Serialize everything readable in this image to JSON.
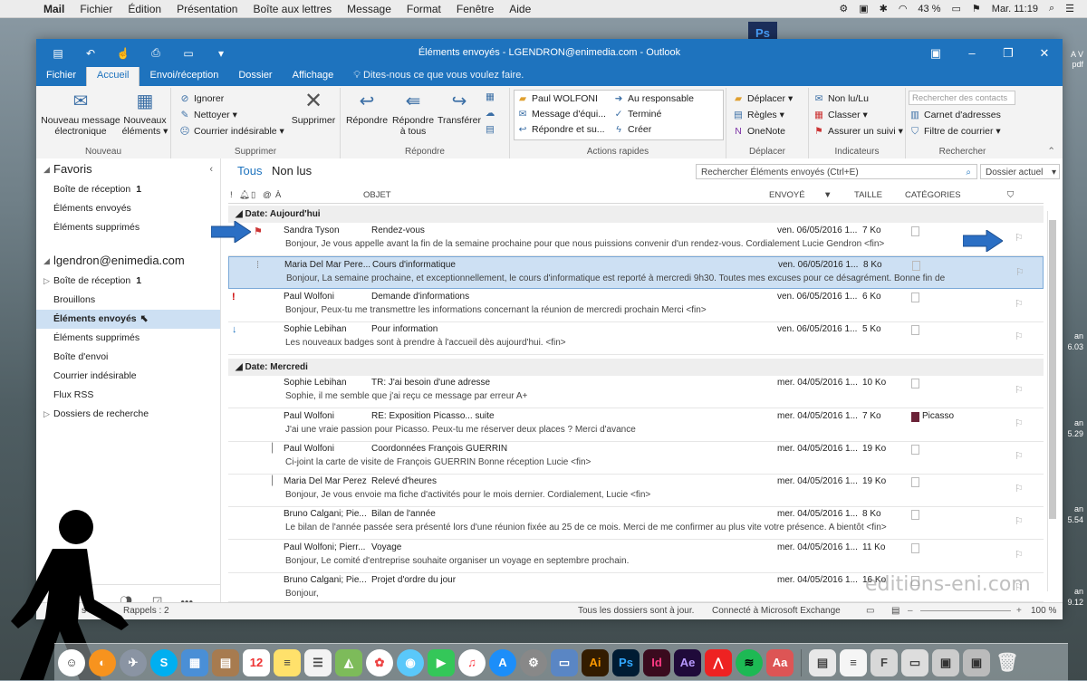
{
  "menubar": {
    "app": "Mail",
    "items": [
      "Fichier",
      "Édition",
      "Présentation",
      "Boîte aux lettres",
      "Message",
      "Format",
      "Fenêtre",
      "Aide"
    ],
    "battery": "43 %",
    "clock": "Mar. 11:19"
  },
  "desktop": {
    "ps_icon": "Ps",
    "side_labels": [
      "A V",
      "pdf",
      "an",
      "6.03",
      "an",
      "5.29",
      "an",
      "5.54",
      "an",
      "9.12"
    ]
  },
  "window": {
    "title": "Éléments envoyés - LGENDRON@enimedia.com - Outlook"
  },
  "tabs": [
    "Fichier",
    "Accueil",
    "Envoi/réception",
    "Dossier",
    "Affichage",
    "Dites-nous ce que vous voulez faire."
  ],
  "ribbon": {
    "nouveau": {
      "msg1": "Nouveau message",
      "msg2": "électronique",
      "el1": "Nouveaux",
      "el2": "éléments",
      "label": "Nouveau"
    },
    "supprimer": {
      "ignorer": "Ignorer",
      "nettoyer": "Nettoyer",
      "courrier": "Courrier indésirable",
      "supprimer": "Supprimer",
      "label": "Supprimer"
    },
    "repondre": {
      "repondre": "Répondre",
      "rep_tous1": "Répondre",
      "rep_tous2": "à tous",
      "transferer": "Transférer",
      "label": "Répondre"
    },
    "actions": {
      "paul": "Paul WOLFONI",
      "message": "Message d'équi...",
      "repondre": "Répondre et su...",
      "responsable": "Au responsable",
      "termine": "Terminé",
      "creer": "Créer",
      "label": "Actions rapides"
    },
    "deplacer": {
      "deplacer": "Déplacer",
      "regles": "Règles",
      "onenote": "OneNote",
      "label": "Déplacer"
    },
    "indicateurs": {
      "nonlu": "Non lu/Lu",
      "classer": "Classer",
      "suivi": "Assurer un suivi",
      "label": "Indicateurs"
    },
    "rechercher": {
      "placeholder": "Rechercher des contacts",
      "carnet": "Carnet d'adresses",
      "filtre": "Filtre de courrier",
      "label": "Rechercher"
    }
  },
  "folders": {
    "favoris_title": "Favoris",
    "favoris": [
      {
        "name": "Boîte de réception",
        "count": "1"
      },
      {
        "name": "Éléments envoyés",
        "count": ""
      },
      {
        "name": "Éléments supprimés",
        "count": ""
      }
    ],
    "account": "lgendron@enimedia.com",
    "account_folders": [
      {
        "name": "Boîte de réception",
        "count": "1"
      },
      {
        "name": "Brouillons",
        "count": ""
      },
      {
        "name": "Éléments envoyés",
        "count": ""
      },
      {
        "name": "Éléments supprimés",
        "count": ""
      },
      {
        "name": "Boîte d'envoi",
        "count": ""
      },
      {
        "name": "Courrier indésirable",
        "count": ""
      },
      {
        "name": "Flux RSS",
        "count": ""
      },
      {
        "name": "Dossiers de recherche",
        "count": ""
      }
    ]
  },
  "list": {
    "filter_all": "Tous",
    "filter_unread": "Non lus",
    "search_placeholder": "Rechercher Éléments envoyés (Ctrl+E)",
    "scope": "Dossier actuel",
    "columns": {
      "a": "À",
      "objet": "OBJET",
      "envoye": "ENVOYÉ",
      "taille": "TAILLE",
      "categories": "CATÉGORIES"
    },
    "group_today": "Date: Aujourd'hui",
    "group_wednesday": "Date: Mercredi",
    "messages": [
      {
        "from": "Sandra Tyson",
        "subject": "Rendez-vous",
        "date": "ven. 06/05/2016 1...",
        "size": "7 Ko",
        "category": "",
        "preview": "Bonjour,  Je vous appelle avant la fin de la semaine prochaine pour que nous puissions convenir d'un rendez-vous.  Cordialement  Lucie Gendron <fin>"
      },
      {
        "from": "Maria Del Mar Pere...",
        "subject": "Cours d'informatique",
        "date": "ven. 06/05/2016 1...",
        "size": "8 Ko",
        "category": "",
        "preview": "Bonjour,  La semaine prochaine, et exceptionnellement, le cours d'informatique est reporté à mercredi 9h30.  Toutes mes excuses pour ce désagrément.  Bonne fin de"
      },
      {
        "from": "Paul Wolfoni",
        "subject": "Demande d'informations",
        "date": "ven. 06/05/2016 1...",
        "size": "6 Ko",
        "category": "",
        "preview": "Bonjour,  Peux-tu me transmettre les informations concernant la réunion de mercredi prochain  Merci <fin>"
      },
      {
        "from": "Sophie Lebihan",
        "subject": "Pour information",
        "date": "ven. 06/05/2016 1...",
        "size": "5 Ko",
        "category": "",
        "preview": "Les nouveaux badges sont à prendre à l'accueil dès aujourd'hui.  <fin>"
      },
      {
        "from": "Sophie Lebihan",
        "subject": "TR: J'ai besoin d'une adresse",
        "date": "mer. 04/05/2016 1...",
        "size": "10 Ko",
        "category": "",
        "preview": "Sophie, il me semble que j'ai reçu ce message par erreur  A+"
      },
      {
        "from": "Paul Wolfoni",
        "subject": "RE: Exposition Picasso... suite",
        "date": "mer. 04/05/2016 1...",
        "size": "7 Ko",
        "category": "Picasso",
        "preview": "J'ai une vraie passion pour Picasso. Peux-tu me réserver deux places ?  Merci d'avance"
      },
      {
        "from": "Paul Wolfoni",
        "subject": "Coordonnées François GUERRIN",
        "date": "mer. 04/05/2016 1...",
        "size": "19 Ko",
        "category": "",
        "preview": "Ci-joint la carte de visite de François GUERRIN  Bonne réception  Lucie <fin>"
      },
      {
        "from": "Maria Del Mar Perez",
        "subject": "Relevé d'heures",
        "date": "mer. 04/05/2016 1...",
        "size": "19 Ko",
        "category": "",
        "preview": "Bonjour,  Je vous envoie ma fiche d'activités pour le mois dernier.  Cordialement,  Lucie <fin>"
      },
      {
        "from": "Bruno Calgani; Pie...",
        "subject": "Bilan de l'année",
        "date": "mer. 04/05/2016 1...",
        "size": "8 Ko",
        "category": "",
        "preview": "Le bilan de l'année passée sera présenté lors d'une réunion fixée au 25 de ce mois.  Merci de me confirmer au plus vite votre présence.  A bientôt <fin>"
      },
      {
        "from": "Paul Wolfoni; Pierr...",
        "subject": "Voyage",
        "date": "mer. 04/05/2016 1...",
        "size": "11 Ko",
        "category": "",
        "preview": "Bonjour,  Le comité d'entreprise souhaite organiser un voyage en septembre prochain."
      },
      {
        "from": "Bruno Calgani; Pie...",
        "subject": "Projet d'ordre du jour",
        "date": "mer. 04/05/2016 1...",
        "size": "16 Ko",
        "category": "",
        "preview": "Bonjour,"
      }
    ]
  },
  "status": {
    "rappels": "Rappels : 2",
    "left": "s : 1",
    "sync": "Tous les dossiers sont à jour.",
    "connection": "Connecté à Microsoft Exchange",
    "zoom": "100 %"
  },
  "watermark": "editions-eni.com",
  "colors": {
    "accent": "#1e73be",
    "selection": "#cde0f3",
    "picasso": "#6b2238"
  }
}
